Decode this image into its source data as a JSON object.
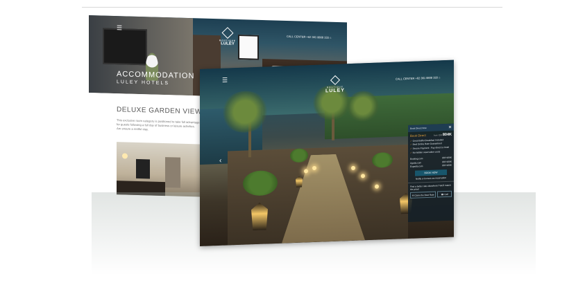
{
  "back_screen": {
    "menu_icon": "hamburger-icon",
    "logo_small": "BOUTIQUE",
    "logo_name": "LULEY",
    "call_center": "CALL CENTER +62 361 8808 333",
    "home_icon": "home-icon",
    "hero_title": "ACCOMMODATION",
    "hero_subtitle": "LULEY HOTELS",
    "section_heading": "DELUXE GARDEN VIEW",
    "section_text": "This exclusive room category is positioned to take full advantage for guests following a full day of business or leisure activities. Am ensure a restful stay."
  },
  "front_screen": {
    "menu_icon": "hamburger-icon",
    "logo_small": "BOUTIQUE",
    "logo_name": "LULEY",
    "call_center": "CALL CENTER +62 361 8808 333",
    "home_icon": "home-icon",
    "prev_icon": "chevron-left-icon",
    "booking": {
      "title": "Book Direct Now",
      "close_icon": "close-icon",
      "direct_label": "Book Direct",
      "from_label": "from IDR",
      "price": "804K",
      "perks": [
        "Great Buffet Breakfast Included",
        "Best Online Rate Guaranteed",
        "Secure Payment - Pay direct to Hotel",
        "No hidden reservation costs"
      ],
      "otas": [
        {
          "name": "Booking.com",
          "price": "IDR 969K"
        },
        {
          "name": "Agoda.com",
          "price": "IDR 969K"
        },
        {
          "name": "Expedia.com",
          "price": "IDR 969K"
        }
      ],
      "book_button": "BOOK NOW",
      "notify": "Notify a Correct.om reservation",
      "question": "Find a better rate elsewhere? We'll match the price!",
      "claim_button": "Claim the Best Rate",
      "call_button": "Call"
    }
  }
}
